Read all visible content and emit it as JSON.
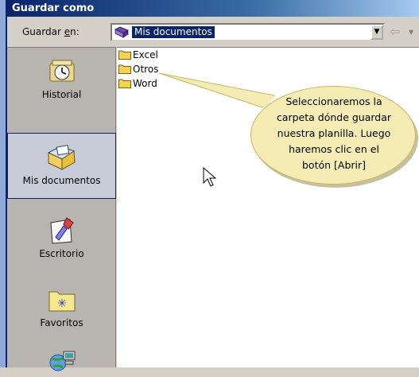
{
  "window": {
    "title": "Guardar como"
  },
  "lookin": {
    "label_pre": "Guardar ",
    "label_u": "e",
    "label_post": "n:",
    "value": "Mis documentos"
  },
  "places": [
    {
      "label": "Historial",
      "icon": "history-icon"
    },
    {
      "label": "Mis documentos",
      "icon": "my-documents-icon",
      "selected": true
    },
    {
      "label": "Escritorio",
      "icon": "desktop-icon"
    },
    {
      "label": "Favoritos",
      "icon": "favorites-icon"
    },
    {
      "label": "",
      "icon": "network-icon"
    }
  ],
  "files": [
    {
      "name": "Excel",
      "icon": "folder-icon"
    },
    {
      "name": "Otros",
      "icon": "folder-icon"
    },
    {
      "name": "Word",
      "icon": "folder-icon"
    }
  ],
  "callout": {
    "lines": [
      "Seleccionaremos la",
      "carpeta dónde guardar",
      "nuestra planilla. Luego",
      "haremos clic en el",
      "botón [Abrir]"
    ]
  }
}
